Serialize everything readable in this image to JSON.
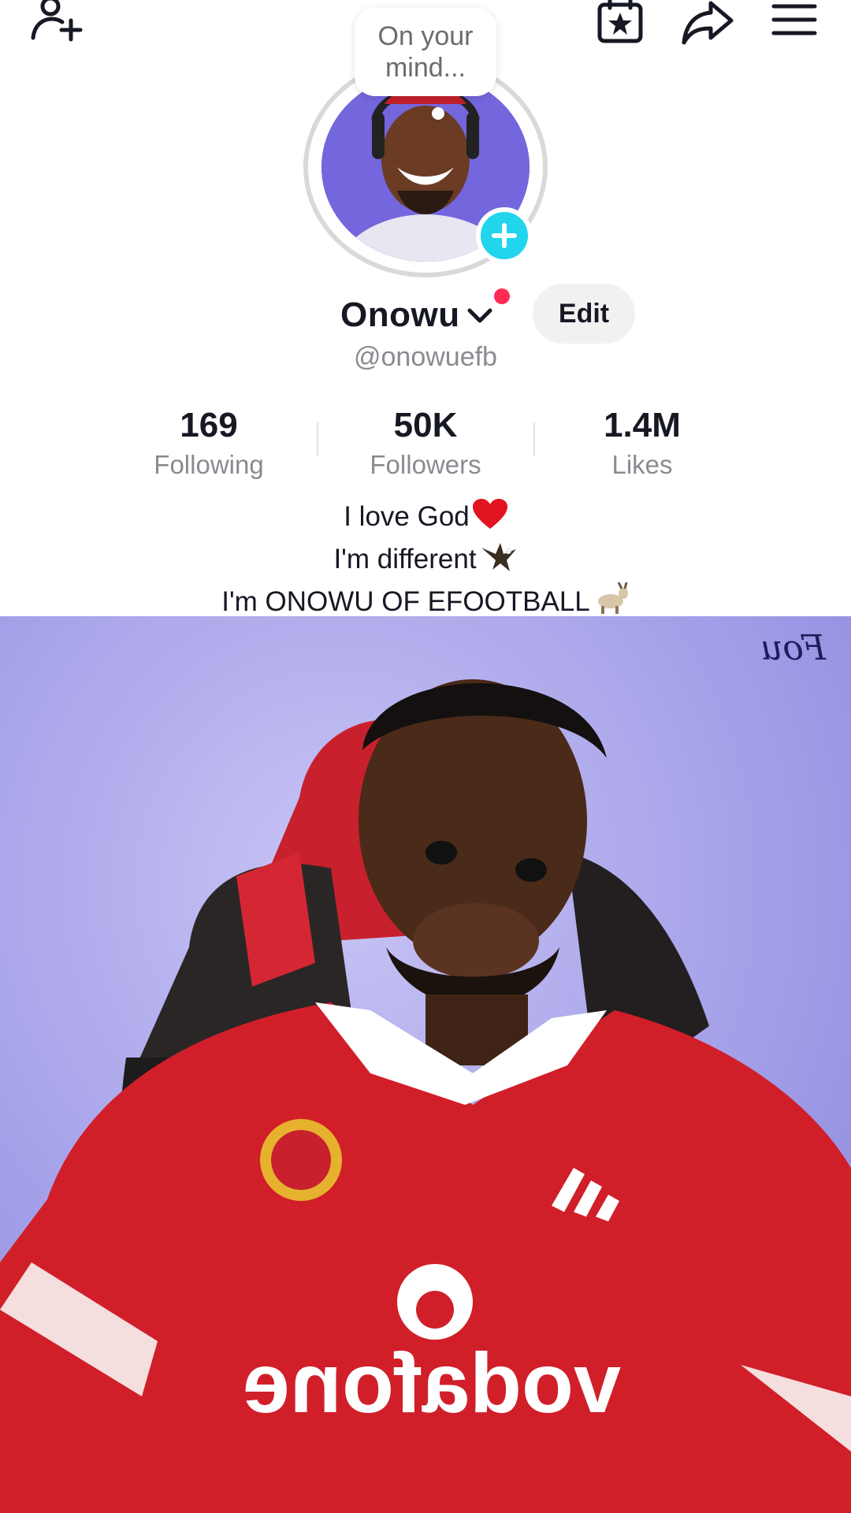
{
  "header": {
    "icons": [
      "add-friend-icon",
      "events-calendar-icon",
      "share-icon",
      "menu-icon"
    ]
  },
  "note": {
    "text": "On your mind..."
  },
  "profile": {
    "name": "Onowu",
    "username": "@onowuefb",
    "edit_label": "Edit"
  },
  "stats": {
    "following": {
      "value": "169",
      "label": "Following"
    },
    "followers": {
      "value": "50K",
      "label": "Followers"
    },
    "likes": {
      "value": "1.4M",
      "label": "Likes"
    }
  },
  "bio": {
    "line1": "I love God",
    "line2": "I'm different",
    "line3": "I'm ONOWU OF EFOOTBALL"
  },
  "video": {
    "wall_text": "Fou",
    "jersey_sponsor": "vodafone"
  },
  "colors": {
    "accent_story": "#20d5ec",
    "notification_dot": "#fe2c55",
    "video_background": "#a9a6ec",
    "jersey_red": "#d11f2a"
  }
}
